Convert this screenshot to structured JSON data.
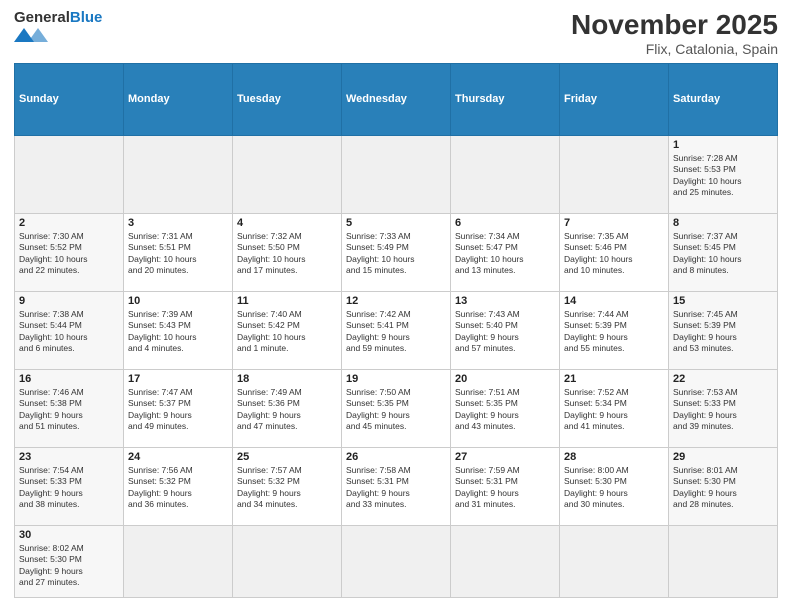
{
  "header": {
    "logo_general": "General",
    "logo_blue": "Blue",
    "title": "November 2025",
    "subtitle": "Flix, Catalonia, Spain"
  },
  "weekdays": [
    "Sunday",
    "Monday",
    "Tuesday",
    "Wednesday",
    "Thursday",
    "Friday",
    "Saturday"
  ],
  "weeks": [
    [
      {
        "day": "",
        "info": ""
      },
      {
        "day": "",
        "info": ""
      },
      {
        "day": "",
        "info": ""
      },
      {
        "day": "",
        "info": ""
      },
      {
        "day": "",
        "info": ""
      },
      {
        "day": "",
        "info": ""
      },
      {
        "day": "1",
        "info": "Sunrise: 7:28 AM\nSunset: 5:53 PM\nDaylight: 10 hours\nand 25 minutes."
      }
    ],
    [
      {
        "day": "2",
        "info": "Sunrise: 7:30 AM\nSunset: 5:52 PM\nDaylight: 10 hours\nand 22 minutes."
      },
      {
        "day": "3",
        "info": "Sunrise: 7:31 AM\nSunset: 5:51 PM\nDaylight: 10 hours\nand 20 minutes."
      },
      {
        "day": "4",
        "info": "Sunrise: 7:32 AM\nSunset: 5:50 PM\nDaylight: 10 hours\nand 17 minutes."
      },
      {
        "day": "5",
        "info": "Sunrise: 7:33 AM\nSunset: 5:49 PM\nDaylight: 10 hours\nand 15 minutes."
      },
      {
        "day": "6",
        "info": "Sunrise: 7:34 AM\nSunset: 5:47 PM\nDaylight: 10 hours\nand 13 minutes."
      },
      {
        "day": "7",
        "info": "Sunrise: 7:35 AM\nSunset: 5:46 PM\nDaylight: 10 hours\nand 10 minutes."
      },
      {
        "day": "8",
        "info": "Sunrise: 7:37 AM\nSunset: 5:45 PM\nDaylight: 10 hours\nand 8 minutes."
      }
    ],
    [
      {
        "day": "9",
        "info": "Sunrise: 7:38 AM\nSunset: 5:44 PM\nDaylight: 10 hours\nand 6 minutes."
      },
      {
        "day": "10",
        "info": "Sunrise: 7:39 AM\nSunset: 5:43 PM\nDaylight: 10 hours\nand 4 minutes."
      },
      {
        "day": "11",
        "info": "Sunrise: 7:40 AM\nSunset: 5:42 PM\nDaylight: 10 hours\nand 1 minute."
      },
      {
        "day": "12",
        "info": "Sunrise: 7:42 AM\nSunset: 5:41 PM\nDaylight: 9 hours\nand 59 minutes."
      },
      {
        "day": "13",
        "info": "Sunrise: 7:43 AM\nSunset: 5:40 PM\nDaylight: 9 hours\nand 57 minutes."
      },
      {
        "day": "14",
        "info": "Sunrise: 7:44 AM\nSunset: 5:39 PM\nDaylight: 9 hours\nand 55 minutes."
      },
      {
        "day": "15",
        "info": "Sunrise: 7:45 AM\nSunset: 5:39 PM\nDaylight: 9 hours\nand 53 minutes."
      }
    ],
    [
      {
        "day": "16",
        "info": "Sunrise: 7:46 AM\nSunset: 5:38 PM\nDaylight: 9 hours\nand 51 minutes."
      },
      {
        "day": "17",
        "info": "Sunrise: 7:47 AM\nSunset: 5:37 PM\nDaylight: 9 hours\nand 49 minutes."
      },
      {
        "day": "18",
        "info": "Sunrise: 7:49 AM\nSunset: 5:36 PM\nDaylight: 9 hours\nand 47 minutes."
      },
      {
        "day": "19",
        "info": "Sunrise: 7:50 AM\nSunset: 5:35 PM\nDaylight: 9 hours\nand 45 minutes."
      },
      {
        "day": "20",
        "info": "Sunrise: 7:51 AM\nSunset: 5:35 PM\nDaylight: 9 hours\nand 43 minutes."
      },
      {
        "day": "21",
        "info": "Sunrise: 7:52 AM\nSunset: 5:34 PM\nDaylight: 9 hours\nand 41 minutes."
      },
      {
        "day": "22",
        "info": "Sunrise: 7:53 AM\nSunset: 5:33 PM\nDaylight: 9 hours\nand 39 minutes."
      }
    ],
    [
      {
        "day": "23",
        "info": "Sunrise: 7:54 AM\nSunset: 5:33 PM\nDaylight: 9 hours\nand 38 minutes."
      },
      {
        "day": "24",
        "info": "Sunrise: 7:56 AM\nSunset: 5:32 PM\nDaylight: 9 hours\nand 36 minutes."
      },
      {
        "day": "25",
        "info": "Sunrise: 7:57 AM\nSunset: 5:32 PM\nDaylight: 9 hours\nand 34 minutes."
      },
      {
        "day": "26",
        "info": "Sunrise: 7:58 AM\nSunset: 5:31 PM\nDaylight: 9 hours\nand 33 minutes."
      },
      {
        "day": "27",
        "info": "Sunrise: 7:59 AM\nSunset: 5:31 PM\nDaylight: 9 hours\nand 31 minutes."
      },
      {
        "day": "28",
        "info": "Sunrise: 8:00 AM\nSunset: 5:30 PM\nDaylight: 9 hours\nand 30 minutes."
      },
      {
        "day": "29",
        "info": "Sunrise: 8:01 AM\nSunset: 5:30 PM\nDaylight: 9 hours\nand 28 minutes."
      }
    ],
    [
      {
        "day": "30",
        "info": "Sunrise: 8:02 AM\nSunset: 5:30 PM\nDaylight: 9 hours\nand 27 minutes."
      },
      {
        "day": "",
        "info": ""
      },
      {
        "day": "",
        "info": ""
      },
      {
        "day": "",
        "info": ""
      },
      {
        "day": "",
        "info": ""
      },
      {
        "day": "",
        "info": ""
      },
      {
        "day": "",
        "info": ""
      }
    ]
  ]
}
